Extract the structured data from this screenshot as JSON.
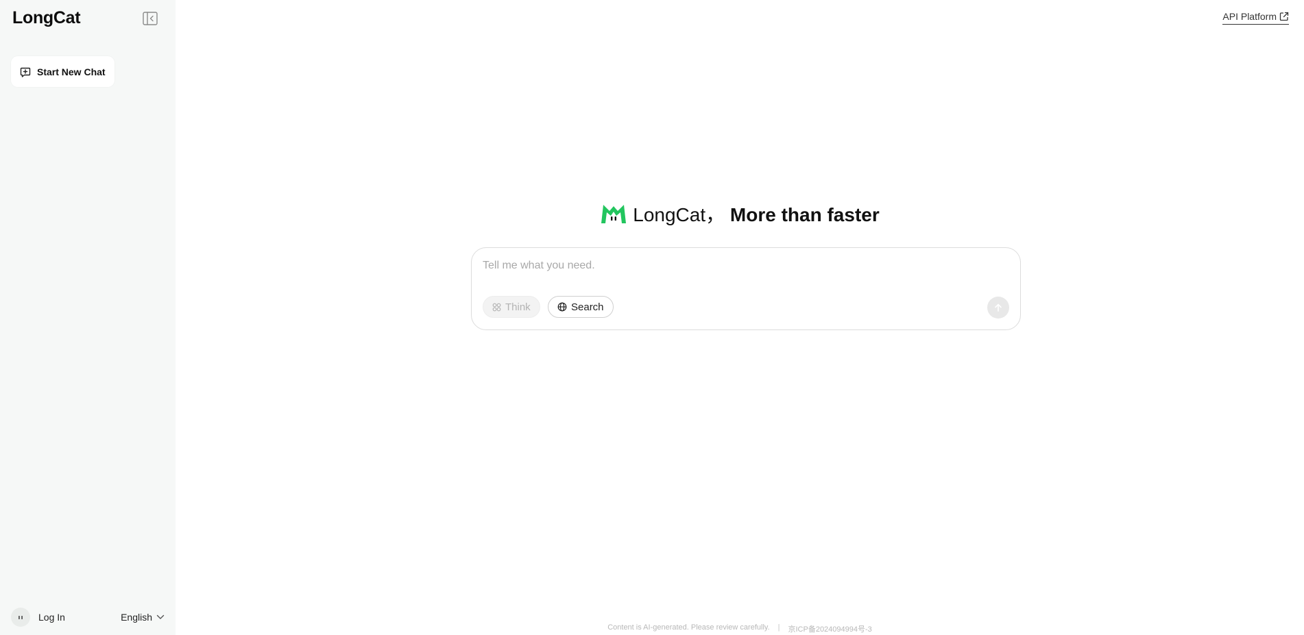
{
  "sidebar": {
    "brand": "LongCat",
    "collapse_icon": "sidebar-collapse-icon",
    "new_chat_label": "Start New Chat",
    "new_chat_icon": "new-chat-icon",
    "login_label": "Log In",
    "language": "English"
  },
  "header": {
    "api_platform_label": "API Platform",
    "external_icon": "external-link-icon"
  },
  "hero": {
    "brand_word": "LongCat",
    "separator": "，",
    "tagline": "More than faster",
    "logo_color": "#22c55e"
  },
  "composer": {
    "placeholder": "Tell me what you need.",
    "value": "",
    "think_label": "Think",
    "search_label": "Search",
    "send_icon": "arrow-up-icon"
  },
  "footer": {
    "disclaimer": "Content is AI-generated. Please review carefully.",
    "separator": "|",
    "icp": "京ICP备2024094994号-3"
  },
  "colors": {
    "sidebar_bg": "#f6f8f7",
    "accent_green": "#22c55e",
    "border": "#dcdcdc"
  }
}
